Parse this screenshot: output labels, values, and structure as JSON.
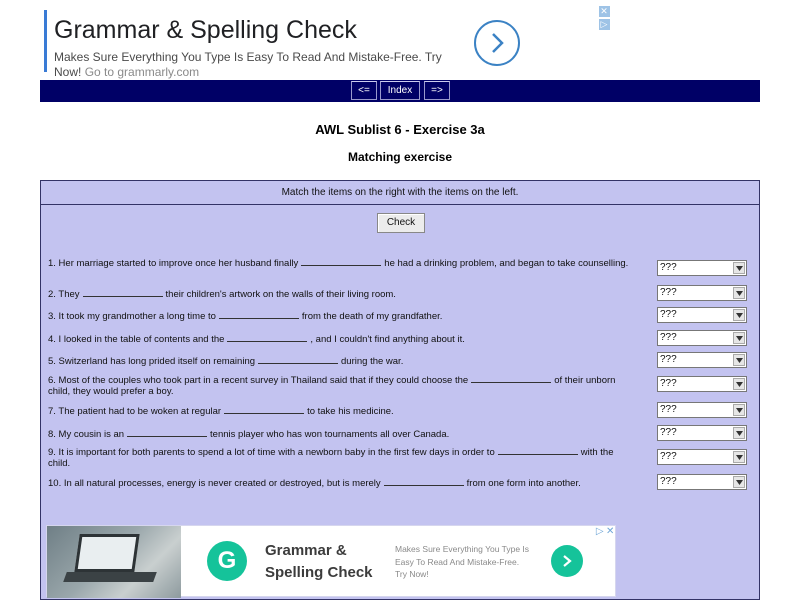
{
  "top_ad": {
    "title": "Grammar & Spelling Check",
    "description": "Makes Sure Everything You Type Is Easy To Read And Mistake-Free. Try Now!",
    "link_text": "Go to grammarly.com",
    "info_icon": "ad-info-icon",
    "close_icon": "ad-close-icon",
    "arrow_icon": "chevron-right-icon"
  },
  "nav": {
    "prev": "<=",
    "index": "Index",
    "next": "=>"
  },
  "page": {
    "title": "AWL Sublist 6 - Exercise 3a",
    "subtitle": "Matching exercise"
  },
  "exercise": {
    "instructions": "Match the items on the right with the items on the left.",
    "check_label": "Check",
    "select_placeholder": "???",
    "questions": [
      {
        "before": "1. Her marriage started to improve once her husband finally",
        "after": "he had a drinking problem, and began to take counselling."
      },
      {
        "before": "2. They",
        "after": "their children's artwork on the walls of their living room."
      },
      {
        "before": "3. It took my grandmother a long time to",
        "after": "from the death of my grandfather."
      },
      {
        "before": "4. I looked in the table of contents and the",
        "after": ", and I couldn't find anything about it."
      },
      {
        "before": "5. Switzerland has long prided itself on remaining",
        "after": "during the war."
      },
      {
        "before": "6. Most of the couples who took part in a recent survey in Thailand said that if they could choose the",
        "after": "of their unborn child, they would prefer a boy."
      },
      {
        "before": "7. The patient had to be woken at regular",
        "after": "to take his medicine."
      },
      {
        "before": "8. My cousin is an",
        "after": "tennis player who has won tournaments all over Canada."
      },
      {
        "before": "9. It is important for both parents to spend a lot of time with a newborn baby in the first few days in order to",
        "after": "with the child."
      },
      {
        "before": "10. In all natural processes, energy is never created or destroyed, but is merely",
        "after": "from one form into another."
      }
    ]
  },
  "bottom_ad": {
    "title": "Grammar & Spelling Check",
    "description": "Makes Sure Everything You Type Is Easy To Read And Mistake-Free. Try Now!",
    "logo_letter": "G",
    "colors": {
      "brand": "#15c39a"
    }
  },
  "colors": {
    "nav_bg": "#000066",
    "panel_bg": "#c3c3f0",
    "accent": "#3b82c4"
  }
}
